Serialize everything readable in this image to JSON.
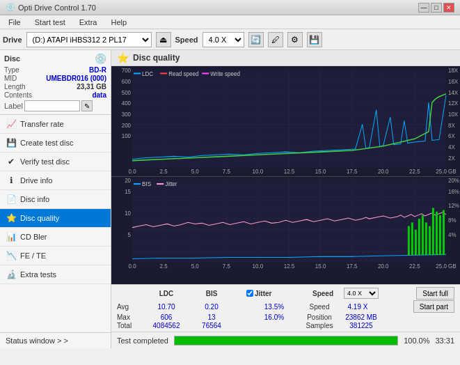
{
  "app": {
    "title": "Opti Drive Control 1.70",
    "title_icon": "💿"
  },
  "title_buttons": {
    "minimize": "—",
    "maximize": "□",
    "close": "✕"
  },
  "menu": {
    "items": [
      "File",
      "Start test",
      "Extra",
      "Help"
    ]
  },
  "drive_bar": {
    "label": "Drive",
    "drive_value": "(D:) ATAPI iHBS312  2 PL17",
    "speed_label": "Speed",
    "speed_value": "4.0 X"
  },
  "disc": {
    "title": "Disc",
    "type_label": "Type",
    "type_value": "BD-R",
    "mid_label": "MID",
    "mid_value": "UMEBDR016 (000)",
    "length_label": "Length",
    "length_value": "23,31 GB",
    "contents_label": "Contents",
    "contents_value": "data",
    "label_label": "Label",
    "label_placeholder": ""
  },
  "nav": {
    "items": [
      {
        "id": "transfer-rate",
        "label": "Transfer rate",
        "icon": "📈"
      },
      {
        "id": "create-test-disc",
        "label": "Create test disc",
        "icon": "💾"
      },
      {
        "id": "verify-test-disc",
        "label": "Verify test disc",
        "icon": "✔"
      },
      {
        "id": "drive-info",
        "label": "Drive info",
        "icon": "ℹ"
      },
      {
        "id": "disc-info",
        "label": "Disc info",
        "icon": "📄"
      },
      {
        "id": "disc-quality",
        "label": "Disc quality",
        "icon": "⭐",
        "active": true
      },
      {
        "id": "cd-bler",
        "label": "CD Bler",
        "icon": "📊"
      },
      {
        "id": "fe-te",
        "label": "FE / TE",
        "icon": "📉"
      },
      {
        "id": "extra-tests",
        "label": "Extra tests",
        "icon": "🔬"
      }
    ],
    "status_window": "Status window > >"
  },
  "chart": {
    "title": "Disc quality",
    "icon": "⭐",
    "top": {
      "legend": [
        {
          "label": "LDC",
          "color": "#00aaff"
        },
        {
          "label": "Read speed",
          "color": "#ff4444"
        },
        {
          "label": "Write speed",
          "color": "#ff44ff"
        }
      ],
      "y_left_max": 700,
      "y_right_labels": [
        "18X",
        "16X",
        "14X",
        "12X",
        "10X",
        "8X",
        "6X",
        "4X",
        "2X"
      ],
      "x_labels": [
        "0.0",
        "2.5",
        "5.0",
        "7.5",
        "10.0",
        "12.5",
        "15.0",
        "17.5",
        "20.0",
        "22.5",
        "25.0 GB"
      ]
    },
    "bottom": {
      "legend": [
        {
          "label": "BIS",
          "color": "#00aaff"
        },
        {
          "label": "Jitter",
          "color": "#ff88cc"
        }
      ],
      "y_left_max": 20,
      "y_right_labels": [
        "20%",
        "16%",
        "12%",
        "8%",
        "4%"
      ],
      "x_labels": [
        "0.0",
        "2.5",
        "5.0",
        "7.5",
        "10.0",
        "12.5",
        "15.0",
        "17.5",
        "20.0",
        "22.5",
        "25.0 GB"
      ]
    }
  },
  "stats": {
    "headers": [
      "LDC",
      "BIS",
      "",
      "Jitter",
      "Speed",
      ""
    ],
    "avg_label": "Avg",
    "avg_ldc": "10.70",
    "avg_bis": "0.20",
    "avg_jitter_pct": "13.5%",
    "avg_speed_label": "Speed",
    "avg_speed_val": "4.19 X",
    "avg_speed_select": "4.0 X",
    "max_label": "Max",
    "max_ldc": "606",
    "max_bis": "13",
    "max_jitter_pct": "16.0%",
    "max_pos_label": "Position",
    "max_pos_val": "23862 MB",
    "total_label": "Total",
    "total_ldc": "4084562",
    "total_bis": "76564",
    "total_samples_label": "Samples",
    "total_samples_val": "381225",
    "start_full_label": "Start full",
    "start_part_label": "Start part"
  },
  "progress": {
    "pct": 100,
    "pct_text": "100.0%",
    "status": "Test completed",
    "time": "33:31"
  },
  "colors": {
    "bg_chart": "#1e1e3a",
    "grid": "#2a2a4a",
    "ldc": "#00aaff",
    "bis": "#00aaff",
    "jitter": "#ff88cc",
    "read_speed": "#ff4444",
    "write_speed": "#ff44ff",
    "green_bars": "#00cc00",
    "active_nav": "#0078d7",
    "progress_fill": "#00bb00"
  }
}
